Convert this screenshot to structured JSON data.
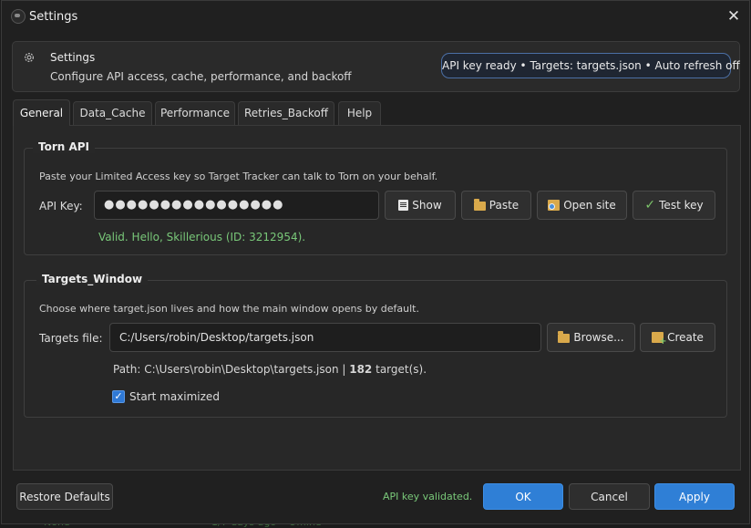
{
  "window": {
    "title": "Settings",
    "close_label": "✕"
  },
  "header": {
    "title": "Settings",
    "subtitle": "Configure API access, cache, performance, and backoff",
    "status": "API key ready  •  Targets: targets.json  •  Auto refresh off"
  },
  "tabs": [
    {
      "label": "General",
      "active": true
    },
    {
      "label": "Data_Cache",
      "active": false
    },
    {
      "label": "Performance",
      "active": false
    },
    {
      "label": "Retries_Backoff",
      "active": false
    },
    {
      "label": "Help",
      "active": false
    }
  ],
  "torn_api": {
    "title": "Torn API",
    "description": "Paste your Limited Access key so Target Tracker can talk to Torn on your behalf.",
    "api_key_label": "API Key:",
    "api_key_value": "●●●●●●●●●●●●●●●●",
    "buttons": {
      "show": "Show",
      "paste": "Paste",
      "open_site": "Open site",
      "test_key": "Test key"
    },
    "validation": "Valid. Hello, Skillerious (ID: 3212954)."
  },
  "targets_window": {
    "title": "Targets_Window",
    "description": "Choose where target.json lives and how the main window opens by default.",
    "file_label": "Targets file:",
    "file_value": "C:/Users/robin/Desktop/targets.json",
    "buttons": {
      "browse": "Browse...",
      "create": "Create"
    },
    "path_prefix": "Path: C:\\Users\\robin\\Desktop\\targets.json | ",
    "target_count": "182",
    "path_suffix": " target(s).",
    "start_maximized_label": "Start maximized",
    "start_maximized_checked": true
  },
  "footer": {
    "restore": "Restore Defaults",
    "status": "API key validated.",
    "ok": "OK",
    "cancel": "Cancel",
    "apply": "Apply"
  },
  "colors": {
    "accent": "#2f7fd6",
    "success": "#79c879",
    "status_border": "#4b6fa5"
  }
}
